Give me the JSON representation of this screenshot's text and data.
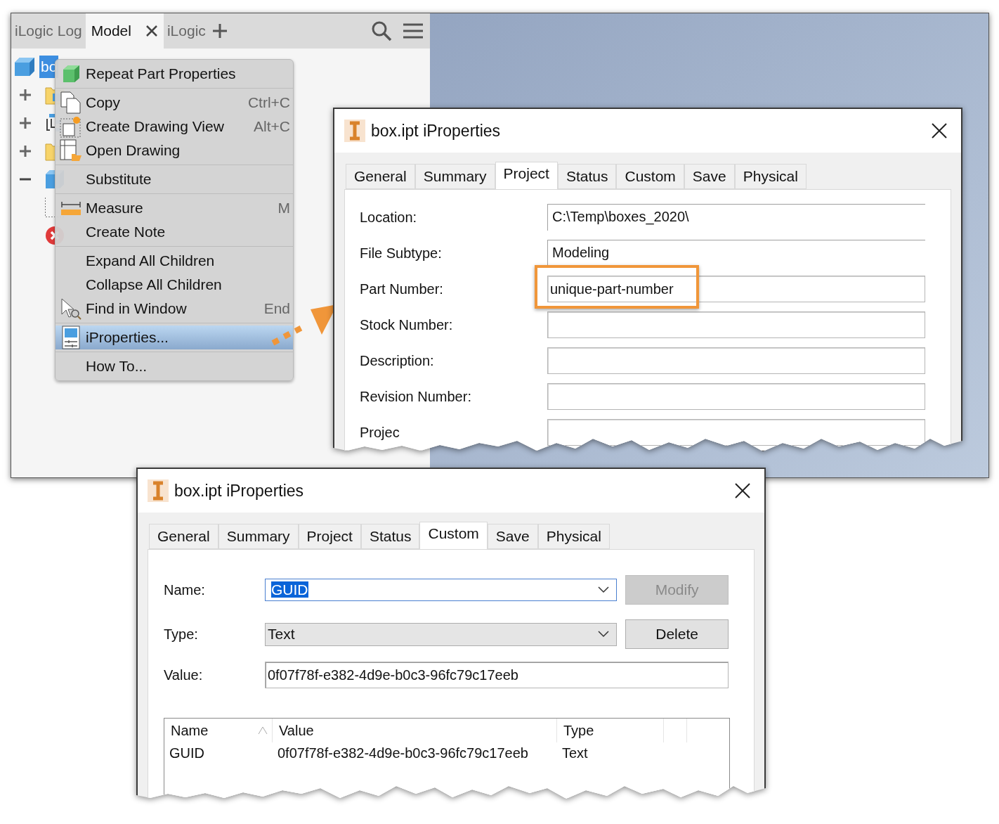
{
  "app": {
    "tabs": [
      {
        "label": "iLogic Log",
        "selected": false,
        "closable": false
      },
      {
        "label": "Model",
        "selected": true,
        "closable": true
      },
      {
        "label": "iLogic",
        "selected": false,
        "closable": false
      }
    ]
  },
  "browser": {
    "root": {
      "label": "bo",
      "selected": true
    },
    "nodes": [
      {
        "kind": "folder-body",
        "expanded": false
      },
      {
        "kind": "view",
        "expanded": false
      },
      {
        "kind": "folder",
        "expanded": false
      },
      {
        "kind": "cube",
        "expanded": true
      },
      {
        "kind": "sketch"
      },
      {
        "kind": "error"
      }
    ]
  },
  "context_menu": {
    "groups": [
      [
        {
          "label": "Repeat Part Properties",
          "kind": "cube",
          "selected": false
        }
      ],
      [
        {
          "label": "Copy",
          "shortcut": "Ctrl+C",
          "kind": "copy",
          "selected": false
        },
        {
          "label": "Create Drawing View",
          "shortcut": "Alt+C",
          "kind": "drawing-view",
          "selected": false
        },
        {
          "label": "Open Drawing",
          "kind": "open-drawing",
          "selected": false
        }
      ],
      [
        {
          "label": "Substitute",
          "kind": "plain",
          "selected": false
        }
      ],
      [
        {
          "label": "Measure",
          "shortcut": "M",
          "kind": "measure",
          "selected": false
        },
        {
          "label": "Create Note",
          "kind": "plain",
          "selected": false
        }
      ],
      [
        {
          "label": "Expand All Children",
          "kind": "plain",
          "selected": false
        },
        {
          "label": "Collapse All Children",
          "kind": "plain",
          "selected": false
        },
        {
          "label": "Find in Window",
          "shortcut": "End",
          "kind": "find",
          "selected": false
        }
      ],
      [
        {
          "label": "iProperties...",
          "kind": "properties",
          "selected": true
        }
      ],
      [
        {
          "label": "How To...",
          "kind": "plain",
          "selected": false
        }
      ]
    ]
  },
  "dialogs": [
    {
      "kind": "project",
      "title": "box.ipt iProperties",
      "tabs": [
        {
          "label": "General",
          "selected": false
        },
        {
          "label": "Summary",
          "selected": false
        },
        {
          "label": "Project",
          "selected": true
        },
        {
          "label": "Status",
          "selected": false
        },
        {
          "label": "Custom",
          "selected": false
        },
        {
          "label": "Save",
          "selected": false
        },
        {
          "label": "Physical",
          "selected": false
        }
      ],
      "fields": [
        {
          "label": "Location:",
          "value": "C:\\Temp\\boxes_2020\\",
          "readonly": true,
          "highlighted": false
        },
        {
          "label": "File Subtype:",
          "value": "Modeling",
          "readonly": true,
          "highlighted": false
        },
        {
          "label": "Part Number:",
          "value": "unique-part-number",
          "readonly": false,
          "highlighted": true
        },
        {
          "label": "Stock Number:",
          "readonly": false,
          "highlighted": false
        },
        {
          "label": "Description:",
          "readonly": false,
          "highlighted": false
        },
        {
          "label": "Revision Number:",
          "readonly": false,
          "highlighted": false
        },
        {
          "label": "Projec",
          "readonly": false,
          "highlighted": false
        }
      ]
    },
    {
      "kind": "custom",
      "title": "box.ipt iProperties",
      "tabs": [
        {
          "label": "General",
          "selected": false
        },
        {
          "label": "Summary",
          "selected": false
        },
        {
          "label": "Project",
          "selected": false
        },
        {
          "label": "Status",
          "selected": false
        },
        {
          "label": "Custom",
          "selected": true
        },
        {
          "label": "Save",
          "selected": false
        },
        {
          "label": "Physical",
          "selected": false
        }
      ],
      "name": {
        "label": "Name:",
        "value": "GUID",
        "value_selected": true
      },
      "modify_button": {
        "label": "Modify",
        "disabled": true
      },
      "type": {
        "label": "Type:",
        "value": "Text"
      },
      "delete_button": {
        "label": "Delete",
        "disabled": false
      },
      "value": {
        "label": "Value:",
        "value": "0f07f78f-e382-4d9e-b0c3-96fc79c17eeb"
      },
      "table": {
        "columns": [
          {
            "label": "Name",
            "sorted": true
          },
          {
            "label": "Value",
            "sorted": false
          },
          {
            "label": "Type",
            "sorted": false
          }
        ],
        "rows": [
          [
            "GUID",
            "0f07f78f-e382-4d9e-b0c3-96fc79c17eeb",
            "Text"
          ]
        ]
      }
    }
  ]
}
